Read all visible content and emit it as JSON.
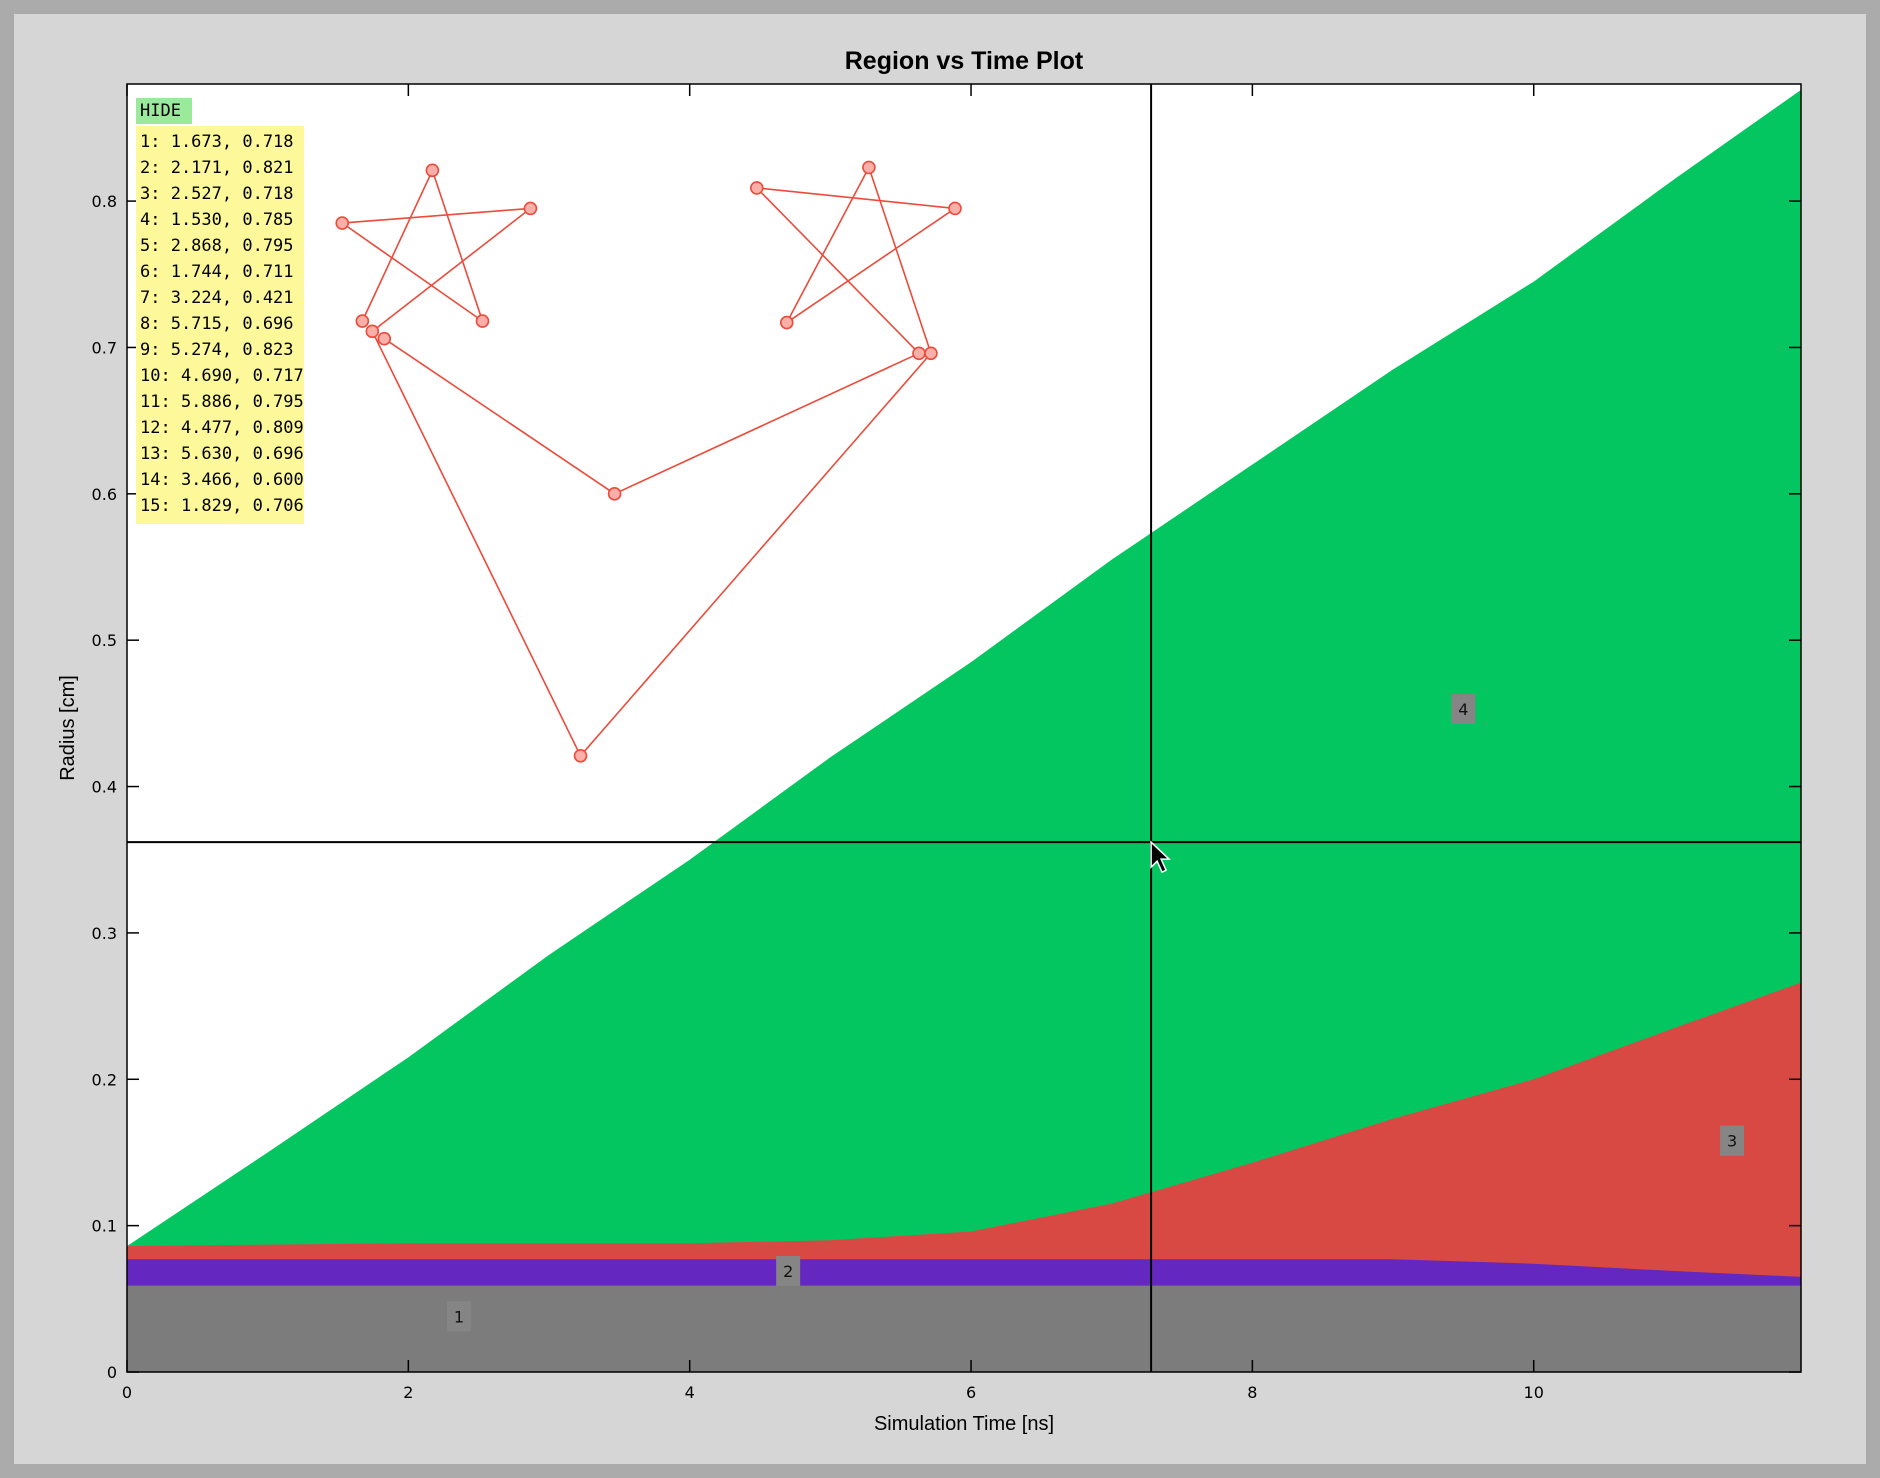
{
  "chart_data": {
    "type": "area",
    "title": "Region vs Time Plot",
    "xlabel": "Simulation Time [ns]",
    "ylabel": "Radius [cm]",
    "xlim": [
      0,
      11.9
    ],
    "ylim": [
      0,
      0.88
    ],
    "x_ticks": [
      0,
      2,
      4,
      6,
      8,
      10
    ],
    "x_tick_labels": [
      "0",
      "2",
      "4",
      "6",
      "8",
      "10"
    ],
    "y_ticks": [
      0,
      0.1,
      0.2,
      0.3,
      0.4,
      0.5,
      0.6,
      0.7,
      0.8
    ],
    "y_tick_labels": [
      "0",
      "0.1",
      "0.2",
      "0.3",
      "0.4",
      "0.5",
      "0.6",
      "0.7",
      "0.8"
    ],
    "grid": false,
    "x": [
      0,
      1,
      2,
      3,
      4,
      5,
      6,
      7,
      8,
      9,
      10,
      11,
      11.9
    ],
    "regions": [
      {
        "label": "1",
        "color": "#7c7c7c",
        "upper": [
          0.059,
          0.059,
          0.059,
          0.059,
          0.059,
          0.059,
          0.059,
          0.059,
          0.059,
          0.059,
          0.059,
          0.059,
          0.059
        ],
        "label_pos": [
          2.36,
          0.038
        ]
      },
      {
        "label": "2",
        "color": "#6428c0",
        "upper": [
          0.077,
          0.077,
          0.077,
          0.077,
          0.077,
          0.077,
          0.077,
          0.077,
          0.077,
          0.077,
          0.074,
          0.069,
          0.065
        ],
        "label_pos": [
          4.7,
          0.069
        ]
      },
      {
        "label": "3",
        "color": "#d94944",
        "upper": [
          0.086,
          0.087,
          0.088,
          0.088,
          0.088,
          0.09,
          0.096,
          0.115,
          0.143,
          0.173,
          0.2,
          0.235,
          0.266
        ],
        "label_pos": [
          11.41,
          0.158
        ]
      },
      {
        "label": "4",
        "color": "#03c660",
        "upper": [
          0.086,
          0.15,
          0.215,
          0.285,
          0.35,
          0.42,
          0.485,
          0.555,
          0.62,
          0.685,
          0.745,
          0.815,
          0.876
        ],
        "label_pos": [
          9.5,
          0.453
        ]
      }
    ],
    "crosshair": {
      "x": 7.28,
      "y": 0.362,
      "color": "#000000"
    },
    "marker_series": {
      "color": "#ec4a3a",
      "fill": "#fab0a8",
      "points": [
        {
          "label": "1",
          "x": 1.673,
          "y": 0.718
        },
        {
          "label": "2",
          "x": 2.171,
          "y": 0.821
        },
        {
          "label": "3",
          "x": 2.527,
          "y": 0.718
        },
        {
          "label": "4",
          "x": 1.53,
          "y": 0.785
        },
        {
          "label": "5",
          "x": 2.868,
          "y": 0.795
        },
        {
          "label": "6",
          "x": 1.744,
          "y": 0.711
        },
        {
          "label": "7",
          "x": 3.224,
          "y": 0.421
        },
        {
          "label": "8",
          "x": 5.715,
          "y": 0.696
        },
        {
          "label": "9",
          "x": 5.274,
          "y": 0.823
        },
        {
          "label": "10",
          "x": 4.69,
          "y": 0.717
        },
        {
          "label": "11",
          "x": 5.886,
          "y": 0.795
        },
        {
          "label": "12",
          "x": 4.477,
          "y": 0.809
        },
        {
          "label": "13",
          "x": 5.63,
          "y": 0.696
        },
        {
          "label": "14",
          "x": 3.466,
          "y": 0.6
        },
        {
          "label": "15",
          "x": 1.829,
          "y": 0.706
        }
      ]
    }
  },
  "points_panel": {
    "hide_label": "HIDE",
    "entries": [
      "1: 1.673, 0.718",
      "2: 2.171, 0.821",
      "3: 2.527, 0.718",
      "4: 1.530, 0.785",
      "5: 2.868, 0.795",
      "6: 1.744, 0.711",
      "7: 3.224, 0.421",
      "8: 5.715, 0.696",
      "9: 5.274, 0.823",
      "10: 4.690, 0.717",
      "11: 5.886, 0.795",
      "12: 4.477, 0.809",
      "13: 5.630, 0.696",
      "14: 3.466, 0.600",
      "15: 1.829, 0.706"
    ]
  },
  "cursor": {
    "icon": "mouse-pointer-icon"
  }
}
